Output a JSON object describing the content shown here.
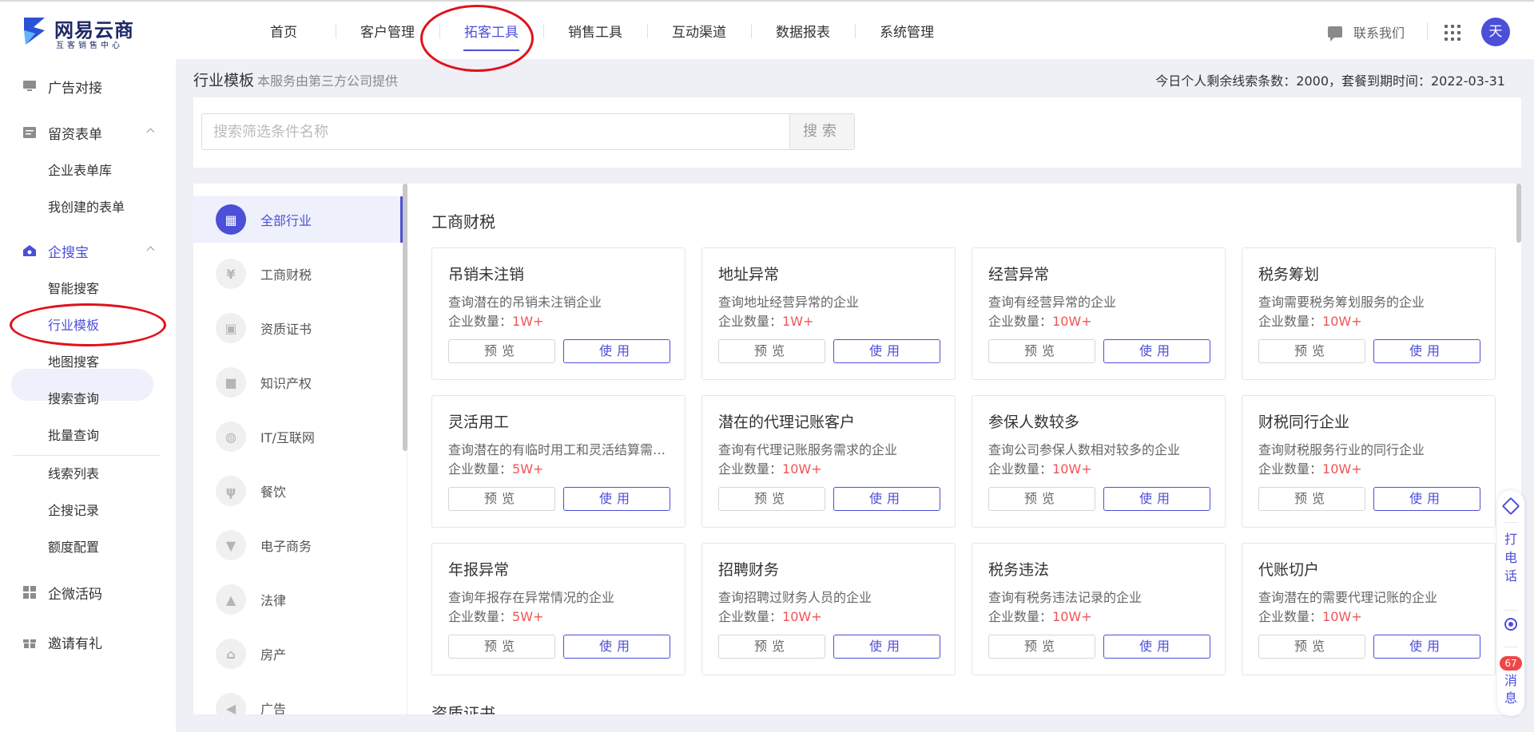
{
  "header": {
    "logo_name": "网易云商",
    "logo_sub": "互客销售中心",
    "nav": [
      "首页",
      "客户管理",
      "拓客工具",
      "销售工具",
      "互动渠道",
      "数据报表",
      "系统管理"
    ],
    "contact": "联系我们",
    "avatar": "天"
  },
  "sidebar": {
    "ad": "广告对接",
    "lead_form": "留资表单",
    "form_lib": "企业表单库",
    "my_forms": "我创建的表单",
    "qisoubao": "企搜宝",
    "smart_search": "智能搜客",
    "industry_template": "行业模板",
    "map_search": "地图搜客",
    "search_query": "搜索查询",
    "batch_query": "批量查询",
    "lead_list": "线索列表",
    "search_record": "企搜记录",
    "quota_config": "额度配置",
    "wecom_code": "企微活码",
    "invite": "邀请有礼"
  },
  "breadcrumb": {
    "title": "行业模板",
    "subtitle": "本服务由第三方公司提供",
    "quota": "今日个人剩余线索条数：2000，套餐到期时间：2022-03-31"
  },
  "search": {
    "placeholder": "搜索筛选条件名称",
    "button": "搜索"
  },
  "categories": [
    {
      "label": "全部行业",
      "glyph": "▦"
    },
    {
      "label": "工商财税",
      "glyph": "¥"
    },
    {
      "label": "资质证书",
      "glyph": "▣"
    },
    {
      "label": "知识产权",
      "glyph": "■"
    },
    {
      "label": "IT/互联网",
      "glyph": "◍"
    },
    {
      "label": "餐饮",
      "glyph": "ψ"
    },
    {
      "label": "电子商务",
      "glyph": "▼"
    },
    {
      "label": "法律",
      "glyph": "▲"
    },
    {
      "label": "房产",
      "glyph": "⌂"
    },
    {
      "label": "广告",
      "glyph": "◀"
    }
  ],
  "section": {
    "title": "工商财税",
    "next_title": "资质证书"
  },
  "card_labels": {
    "count_prefix": "企业数量：",
    "preview": "预览",
    "use": "使用"
  },
  "cards": [
    {
      "title": "吊销未注销",
      "desc": "查询潜在的吊销未注销企业",
      "count": "1W+"
    },
    {
      "title": "地址异常",
      "desc": "查询地址经营异常的企业",
      "count": "1W+"
    },
    {
      "title": "经营异常",
      "desc": "查询有经营异常的企业",
      "count": "10W+"
    },
    {
      "title": "税务筹划",
      "desc": "查询需要税务筹划服务的企业",
      "count": "10W+"
    },
    {
      "title": "灵活用工",
      "desc": "查询潜在的有临时用工和灵活结算需求的企业",
      "count": "5W+"
    },
    {
      "title": "潜在的代理记账客户",
      "desc": "查询有代理记账服务需求的企业",
      "count": "10W+"
    },
    {
      "title": "参保人数较多",
      "desc": "查询公司参保人数相对较多的企业",
      "count": "10W+"
    },
    {
      "title": "财税同行企业",
      "desc": "查询财税服务行业的同行企业",
      "count": "10W+"
    },
    {
      "title": "年报异常",
      "desc": "查询年报存在异常情况的企业",
      "count": "5W+"
    },
    {
      "title": "招聘财务",
      "desc": "查询招聘过财务人员的企业",
      "count": "10W+"
    },
    {
      "title": "税务违法",
      "desc": "查询有税务违法记录的企业",
      "count": "10W+"
    },
    {
      "title": "代账切户",
      "desc": "查询潜在的需要代理记账的企业",
      "count": "10W+"
    }
  ],
  "float_bar": {
    "call": "打电话",
    "badge": "67",
    "message": "消息"
  },
  "colors": {
    "accent": "#4c4fd7",
    "count_red": "#f05454",
    "annotation_red": "#e0121a"
  }
}
